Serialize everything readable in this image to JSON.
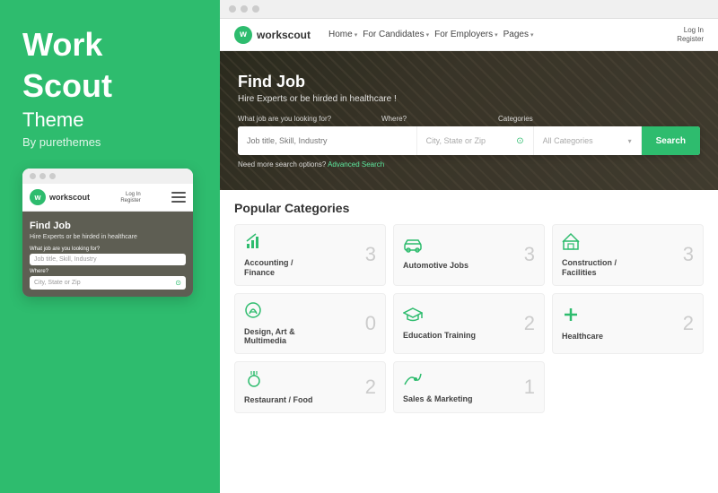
{
  "left": {
    "title_line1": "Work",
    "title_line2": "Scout",
    "subtitle": "Theme",
    "by": "By purethemes"
  },
  "mobile": {
    "logo": "workscout",
    "login": "Log In",
    "register": "Register",
    "hero_title": "Find Job",
    "hero_sub": "Hire Experts or be hirded in healthcare",
    "label_job": "What job are you looking for?",
    "placeholder_job": "Job title, Skill, Industry",
    "label_where": "Where?",
    "placeholder_where": "City, State or Zip"
  },
  "browser": {
    "dots": [
      "dot1",
      "dot2",
      "dot3"
    ]
  },
  "site": {
    "logo": "workscout",
    "nav_items": [
      {
        "label": "Home",
        "has_dropdown": true
      },
      {
        "label": "For Candidates",
        "has_dropdown": true
      },
      {
        "label": "For Employers",
        "has_dropdown": true
      },
      {
        "label": "Pages",
        "has_dropdown": true
      }
    ],
    "nav_right": [
      {
        "label": "Log In"
      },
      {
        "label": "Register"
      }
    ],
    "hero": {
      "title": "Find Job",
      "subtitle": "Hire Experts or be hirded in healthcare !",
      "label_job": "What job are you looking for?",
      "label_where": "Where?",
      "label_categories": "Categories",
      "placeholder_job": "Job title, Skill, Industry",
      "placeholder_where": "City, State or Zip",
      "placeholder_cat": "All Categories",
      "search_btn": "Search",
      "advanced_text": "Need more search options?",
      "advanced_link": "Advanced Search"
    },
    "categories": {
      "title": "Popular Categories",
      "items": [
        {
          "icon": "chart",
          "name": "Accounting /\nFinance",
          "count": "3"
        },
        {
          "icon": "car",
          "name": "Automotive Jobs",
          "count": "3"
        },
        {
          "icon": "building",
          "name": "Construction /\nFacilities",
          "count": "3"
        },
        {
          "icon": "palette",
          "name": "Design, Art &\nMultimedia",
          "count": "0"
        },
        {
          "icon": "graduation",
          "name": "Education Training",
          "count": "2"
        },
        {
          "icon": "health",
          "name": "Healthcare",
          "count": "2"
        },
        {
          "icon": "food",
          "name": "Restaurant / Food",
          "count": "2"
        },
        {
          "icon": "chart2",
          "name": "Sales & Marketing",
          "count": "1"
        }
      ]
    }
  }
}
